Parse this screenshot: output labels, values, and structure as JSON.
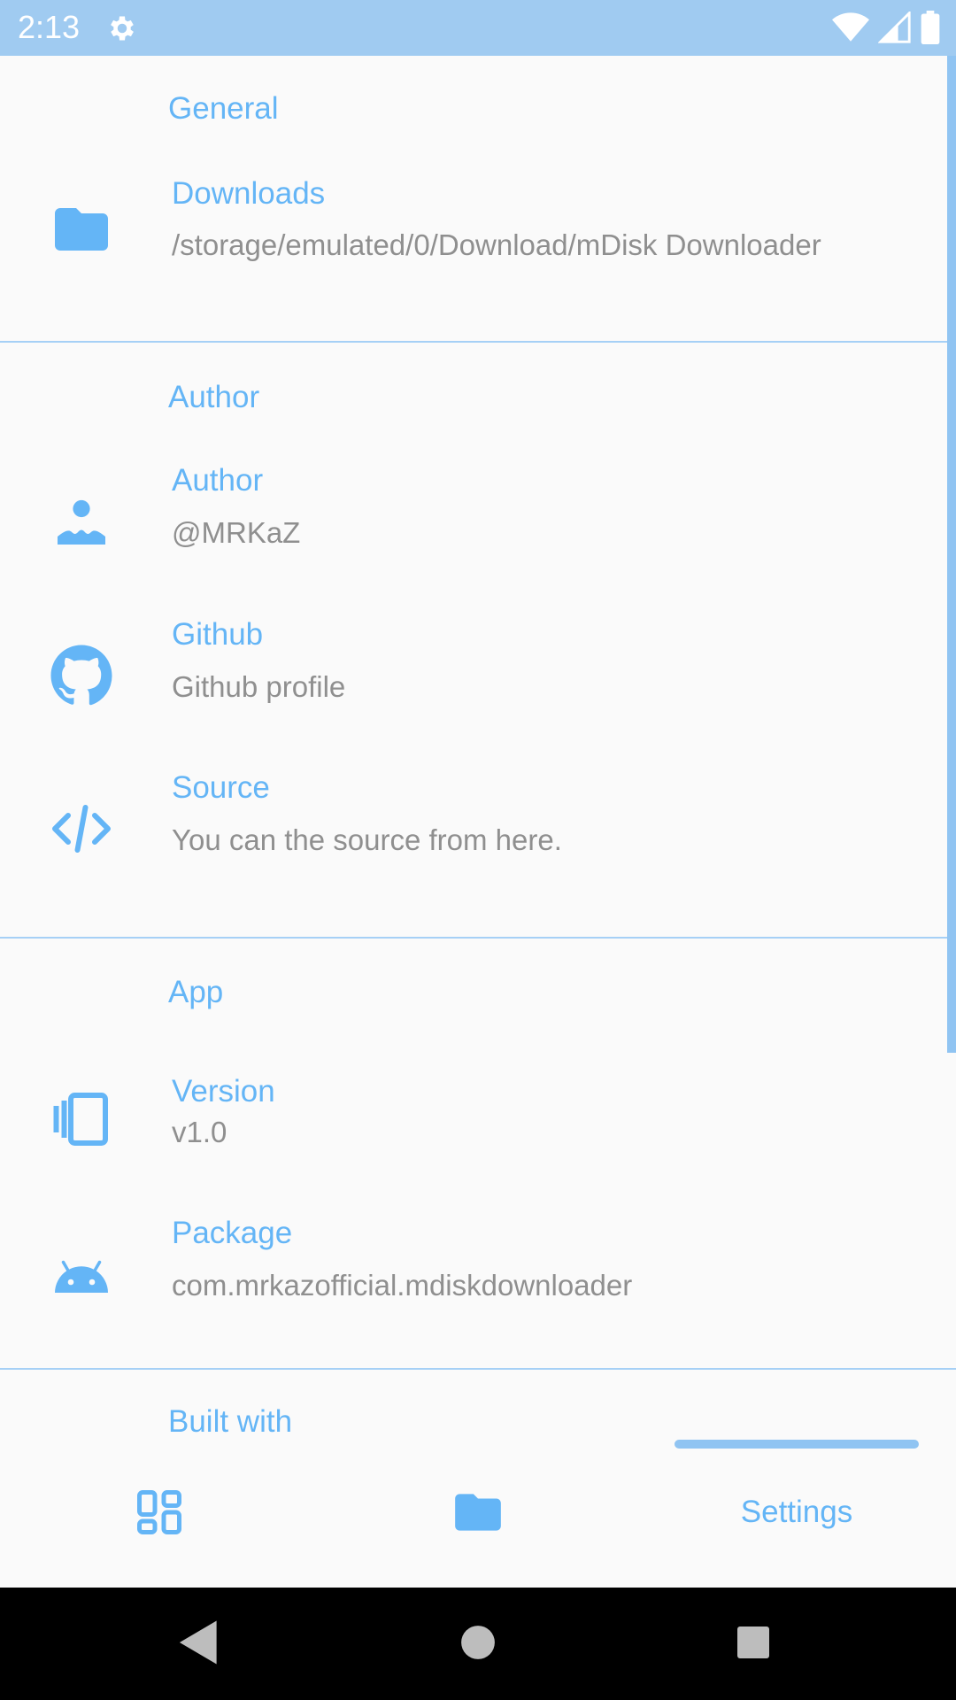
{
  "status_bar": {
    "time": "2:13",
    "icons": [
      "gear-icon",
      "wifi-icon",
      "signal-icon",
      "battery-icon"
    ]
  },
  "sections": {
    "general": {
      "header": "General",
      "downloads": {
        "title": "Downloads",
        "summary": "/storage/emulated/0/Download/mDisk Downloader",
        "icon": "folder-icon"
      }
    },
    "author": {
      "header": "Author",
      "author": {
        "title": "Author",
        "summary": "@MRKaZ",
        "icon": "person-icon"
      },
      "github": {
        "title": "Github",
        "summary": "Github profile",
        "icon": "github-icon"
      },
      "source": {
        "title": "Source",
        "summary": "You can the source from here.",
        "icon": "code-icon"
      }
    },
    "app": {
      "header": "App",
      "version": {
        "title": "Version",
        "summary": "v1.0",
        "icon": "carousel-icon"
      },
      "package": {
        "title": "Package",
        "summary": "com.mrkazofficial.mdiskdownloader",
        "icon": "android-icon"
      }
    },
    "built_with": {
      "header": "Built with"
    }
  },
  "bottom_nav": {
    "items": [
      {
        "icon": "dashboard-icon"
      },
      {
        "icon": "folder-icon"
      },
      {
        "label": "Settings"
      }
    ]
  },
  "colors": {
    "accent": "#64b5f6",
    "status_bar": "#a0cbf1",
    "summary": "#8f8f8f",
    "background": "#fafafa"
  }
}
